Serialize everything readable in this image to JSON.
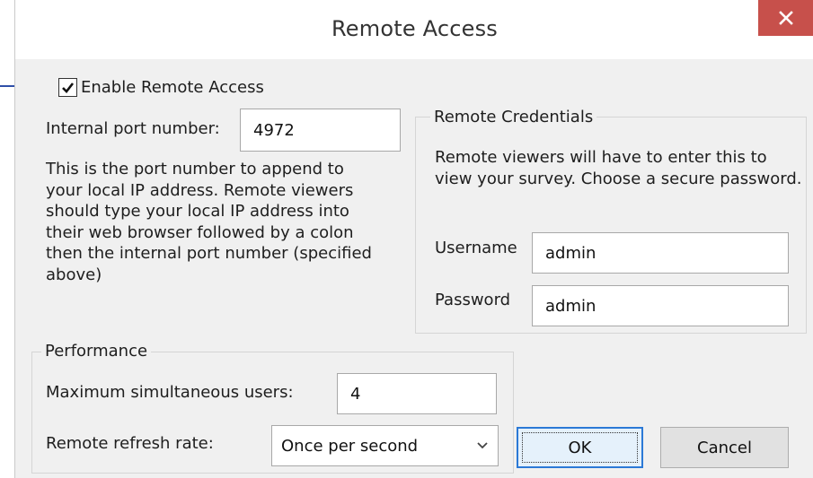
{
  "window": {
    "title": "Remote Access",
    "close_label": "✕"
  },
  "enable": {
    "label": "Enable Remote Access",
    "checked": true
  },
  "port": {
    "label": "Internal port number:",
    "value": "4972"
  },
  "description": "This is the port number to append to\nyour local IP address. Remote viewers\nshould type your local IP address into\ntheir web browser followed by a colon\nthen the internal port number (specified\nabove)",
  "credentials": {
    "legend": "Remote Credentials",
    "description": "Remote viewers will have to enter this to view your survey. Choose a secure password.",
    "username_label": "Username",
    "username_value": "admin",
    "password_label": "Password",
    "password_value": "admin"
  },
  "performance": {
    "legend": "Performance",
    "max_users_label": "Maximum simultaneous users:",
    "max_users_value": "4",
    "refresh_label": "Remote refresh rate:",
    "refresh_value": "Once per second"
  },
  "buttons": {
    "ok": "OK",
    "cancel": "Cancel"
  },
  "colors": {
    "close_button": "#c7504b",
    "focus_border": "#2b79d6",
    "dialog_background": "#f0f0f0"
  }
}
